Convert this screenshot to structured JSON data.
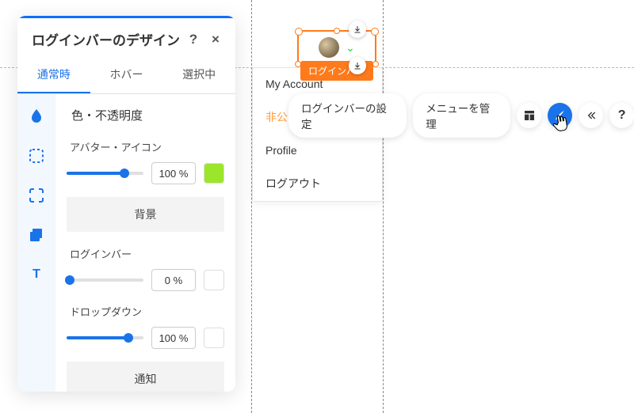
{
  "panel": {
    "title": "ログインバーのデザイン",
    "tabs": [
      "通常時",
      "ホバー",
      "選択中"
    ],
    "activeTab": 0,
    "section": "色・不透明度",
    "controls": [
      {
        "label": "アバター・アイコン",
        "percent": "100 %",
        "swatch": "#9be62a",
        "fill_pct": 75
      },
      {
        "label": "ログインバー",
        "percent": "0 %",
        "swatch": "#ffffff",
        "fill_pct": 4
      },
      {
        "label": "ドロップダウン",
        "percent": "100 %",
        "swatch": "#ffffff",
        "fill_pct": 80
      }
    ],
    "buttons": {
      "background": "背景",
      "notice": "通知"
    },
    "rail_icons": [
      "drop-icon",
      "corners-dashed-icon",
      "corners-solid-icon",
      "layers-icon",
      "text-icon"
    ]
  },
  "dropdown": {
    "items": [
      "My Account",
      "非公開会員ページ",
      "Profile",
      "ログアウト"
    ],
    "activeIndex": 1
  },
  "selection": {
    "label": "ログインバー"
  },
  "options": {
    "settings_label": "ログインバーの設定",
    "manage_label": "メニューを管理"
  }
}
